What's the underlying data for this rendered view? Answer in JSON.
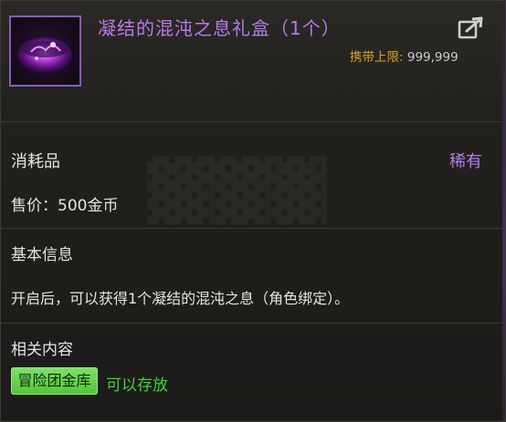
{
  "item": {
    "title": "凝结的混沌之息礼盒（1个）",
    "icon": "purple-chaos-orb-icon",
    "carry_limit_label": "携带上限",
    "carry_limit_sep": ":",
    "carry_limit_value": "999,999"
  },
  "details": {
    "type": "消耗品",
    "rarity": "稀有",
    "price": "售价：500金币"
  },
  "basic_info": {
    "title": "基本信息",
    "description": "开启后，可以获得1个凝结的混沌之息（角色绑定）。"
  },
  "related": {
    "title": "相关内容",
    "badge": "冒险团金库",
    "status": "可以存放"
  },
  "colors": {
    "title_purple": "#b57be8",
    "gold": "#d8a22b",
    "green": "#3fd23a",
    "badge_green": "#5fcf45"
  },
  "icons": [
    "purple-chaos-orb-icon",
    "share-icon"
  ]
}
